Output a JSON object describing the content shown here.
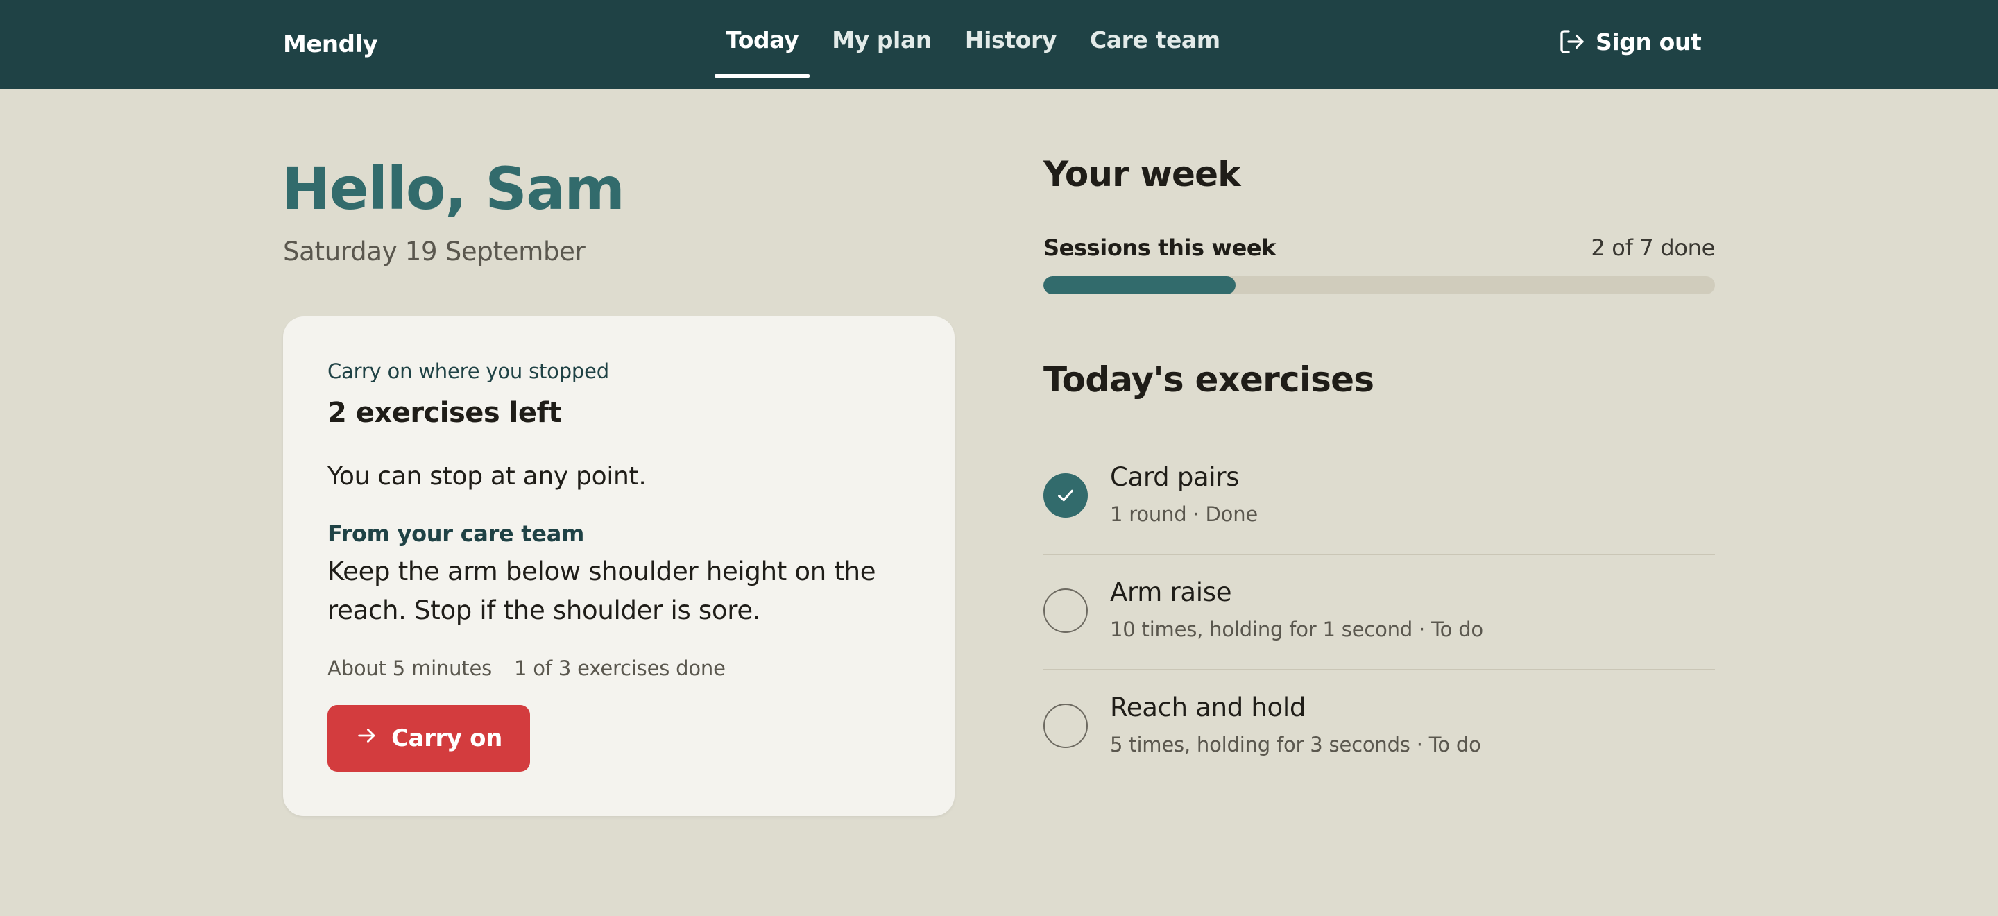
{
  "header": {
    "brand": "Mendly",
    "nav": [
      {
        "label": "Today",
        "active": true
      },
      {
        "label": "My plan",
        "active": false
      },
      {
        "label": "History",
        "active": false
      },
      {
        "label": "Care team",
        "active": false
      }
    ],
    "sign_out_label": "Sign out",
    "background": "#1f4245"
  },
  "greeting": {
    "title": "Hello, Sam",
    "date": "Saturday 19 September"
  },
  "continue_card": {
    "eyebrow": "Carry on where you stopped",
    "remaining": "2 exercises left",
    "stop_note": "You can stop at any point.",
    "care_heading": "From your care team",
    "care_note": "Keep the arm below shoulder height on the reach. Stop if the shoulder is sore.",
    "duration": "About 5 minutes",
    "progress_text": "1 of 3 exercises done",
    "button_label": "Carry on",
    "button_color": "#d33c3e"
  },
  "week": {
    "title": "Your week",
    "sessions_label": "Sessions this week",
    "sessions_count": "2 of 7 done",
    "sessions_done": 2,
    "sessions_total": 7,
    "accent": "#326b6c"
  },
  "exercises": {
    "title": "Today's exercises",
    "items": [
      {
        "name": "Card pairs",
        "detail": "1 round · Done",
        "done": true
      },
      {
        "name": "Arm raise",
        "detail": "10 times, holding for 1 second · To do",
        "done": false
      },
      {
        "name": "Reach and hold",
        "detail": "5 times, holding for 3 seconds · To do",
        "done": false
      }
    ]
  }
}
